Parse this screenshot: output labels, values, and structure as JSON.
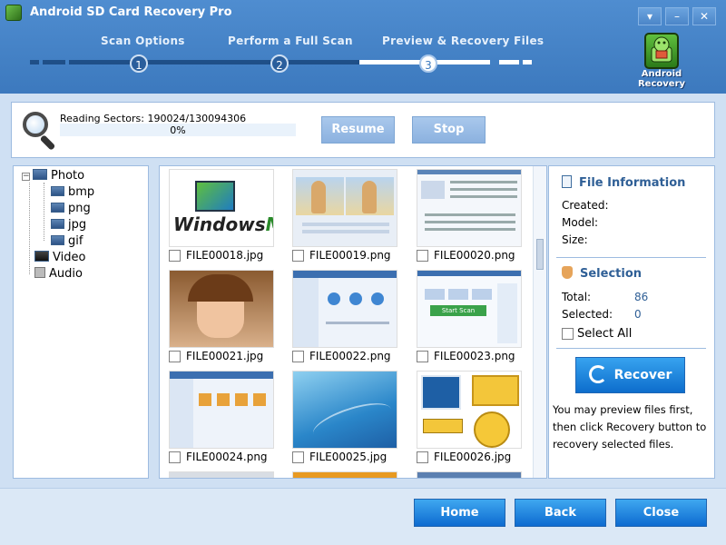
{
  "window": {
    "title": "Android SD Card Recovery Pro",
    "controls": [
      "▾",
      "–",
      "✕"
    ]
  },
  "steps": [
    {
      "label": "Scan Options",
      "number": "1"
    },
    {
      "label": "Perform a Full Scan",
      "number": "2"
    },
    {
      "label": "Preview & Recovery Files",
      "number": "3"
    }
  ],
  "brand": {
    "label": "Android Recovery"
  },
  "scan": {
    "status": "Reading Sectors: 190024/130094306",
    "progress_text": "0%",
    "progress": 0,
    "resume_label": "Resume",
    "stop_label": "Stop"
  },
  "tree": {
    "photo": "Photo",
    "bmp": "bmp",
    "png": "png",
    "jpg": "jpg",
    "gif": "gif",
    "video": "Video",
    "audio": "Audio"
  },
  "files": [
    {
      "name": "FILE00018.jpg"
    },
    {
      "name": "FILE00019.png"
    },
    {
      "name": "FILE00020.png"
    },
    {
      "name": "FILE00021.jpg"
    },
    {
      "name": "FILE00022.png"
    },
    {
      "name": "FILE00023.png"
    },
    {
      "name": "FILE00024.png"
    },
    {
      "name": "FILE00025.jpg"
    },
    {
      "name": "FILE00026.jpg"
    }
  ],
  "thumbs": {
    "windows_me": "Windows",
    "windows_me_suffix": "Me",
    "start_scan": "Start Scan"
  },
  "info": {
    "file_information": "File Information",
    "created": "Created:",
    "model": "Model:",
    "size": "Size:",
    "selection": "Selection",
    "total_label": "Total:",
    "total_value": "86",
    "selected_label": "Selected:",
    "selected_value": "0",
    "select_all": "Select All",
    "recover_label": "Recover",
    "hint": "You may preview files first, then click Recovery button to recovery selected files."
  },
  "footer": {
    "home": "Home",
    "back": "Back",
    "close": "Close"
  }
}
